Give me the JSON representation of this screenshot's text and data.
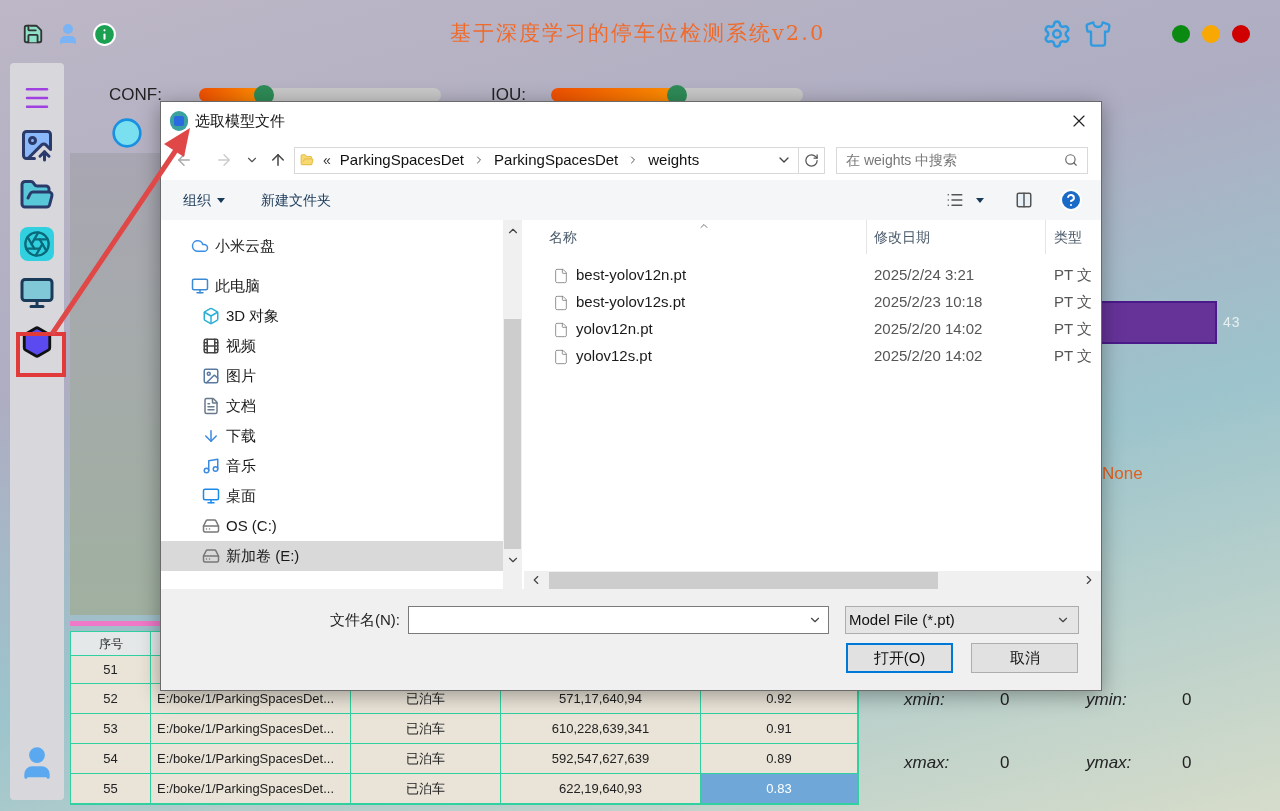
{
  "app": {
    "title": "基于深度学习的停车位检测系统v2.0"
  },
  "sliders": [
    {
      "label": "CONF:",
      "level": 0.27
    },
    {
      "label": "IOU:",
      "level": 0.5
    }
  ],
  "stats": {
    "bar_label": "43",
    "result": "None"
  },
  "coords": [
    {
      "label": "xmin:",
      "value": "0"
    },
    {
      "label": "ymin:",
      "value": "0"
    },
    {
      "label": "xmax:",
      "value": "0"
    },
    {
      "label": "ymax:",
      "value": "0"
    }
  ],
  "table": {
    "columns": [
      "序号"
    ],
    "rows": [
      {
        "cells": [
          {
            "text": "51",
            "selected": false
          }
        ]
      },
      {
        "cells": [
          {
            "text": "52",
            "selected": false
          },
          {
            "text": "E:/boke/1/ParkingSpacesDet...",
            "selected": false
          },
          {
            "text": "已泊车",
            "selected": false
          },
          {
            "text": "571,17,640,94",
            "selected": false
          },
          {
            "text": "0.92",
            "selected": false
          }
        ]
      },
      {
        "cells": [
          {
            "text": "53",
            "selected": false
          },
          {
            "text": "E:/boke/1/ParkingSpacesDet...",
            "selected": false
          },
          {
            "text": "已泊车",
            "selected": false
          },
          {
            "text": "610,228,639,341",
            "selected": false
          },
          {
            "text": "0.91",
            "selected": false
          }
        ]
      },
      {
        "cells": [
          {
            "text": "54",
            "selected": false
          },
          {
            "text": "E:/boke/1/ParkingSpacesDet...",
            "selected": false
          },
          {
            "text": "已泊车",
            "selected": false
          },
          {
            "text": "592,547,627,639",
            "selected": false
          },
          {
            "text": "0.89",
            "selected": false
          }
        ]
      },
      {
        "cells": [
          {
            "text": "55",
            "selected": false
          },
          {
            "text": "E:/boke/1/ParkingSpacesDet...",
            "selected": false
          },
          {
            "text": "已泊车",
            "selected": false
          },
          {
            "text": "622,19,640,93",
            "selected": false
          },
          {
            "text": "0.83",
            "selected": true
          }
        ]
      }
    ]
  },
  "dialog": {
    "title": "选取模型文件",
    "path": {
      "prefix": "«",
      "segments": [
        "ParkingSpacesDet",
        "ParkingSpacesDet",
        "weights"
      ]
    },
    "search": {
      "placeholder": "在 weights 中搜索"
    },
    "toolbar": [
      {
        "label": "组织",
        "kind": "menu"
      },
      {
        "label": "新建文件夹",
        "kind": "button"
      }
    ],
    "nav_pane": [
      {
        "label": "小米云盘",
        "kind": "cloud",
        "selected": false
      },
      {
        "label": "此电脑",
        "kind": "computer",
        "selected": false,
        "children": [
          {
            "label": "3D 对象",
            "kind": "cube",
            "selected": false
          },
          {
            "label": "视频",
            "kind": "video",
            "selected": false
          },
          {
            "label": "图片",
            "kind": "pictures",
            "selected": false
          },
          {
            "label": "文档",
            "kind": "documents",
            "selected": false
          },
          {
            "label": "下载",
            "kind": "downloads",
            "selected": false
          },
          {
            "label": "音乐",
            "kind": "music",
            "selected": false
          },
          {
            "label": "桌面",
            "kind": "desktop",
            "selected": false
          },
          {
            "label": "OS (C:)",
            "kind": "drive",
            "selected": false
          },
          {
            "label": "新加卷 (E:)",
            "kind": "drive",
            "selected": true
          }
        ]
      }
    ],
    "file_columns": [
      "名称",
      "修改日期",
      "类型"
    ],
    "files": [
      {
        "name": "best-yolov12n.pt",
        "date": "2025/2/24 3:21",
        "type": "PT 文"
      },
      {
        "name": "best-yolov12s.pt",
        "date": "2025/2/23 10:18",
        "type": "PT 文"
      },
      {
        "name": "yolov12n.pt",
        "date": "2025/2/20 14:02",
        "type": "PT 文"
      },
      {
        "name": "yolov12s.pt",
        "date": "2025/2/20 14:02",
        "type": "PT 文"
      }
    ],
    "filename_label": "文件名(N):",
    "filter": "Model File (*.pt)",
    "buttons": [
      {
        "label": "打开(O)",
        "default": true
      },
      {
        "label": "取消",
        "default": false
      }
    ]
  }
}
